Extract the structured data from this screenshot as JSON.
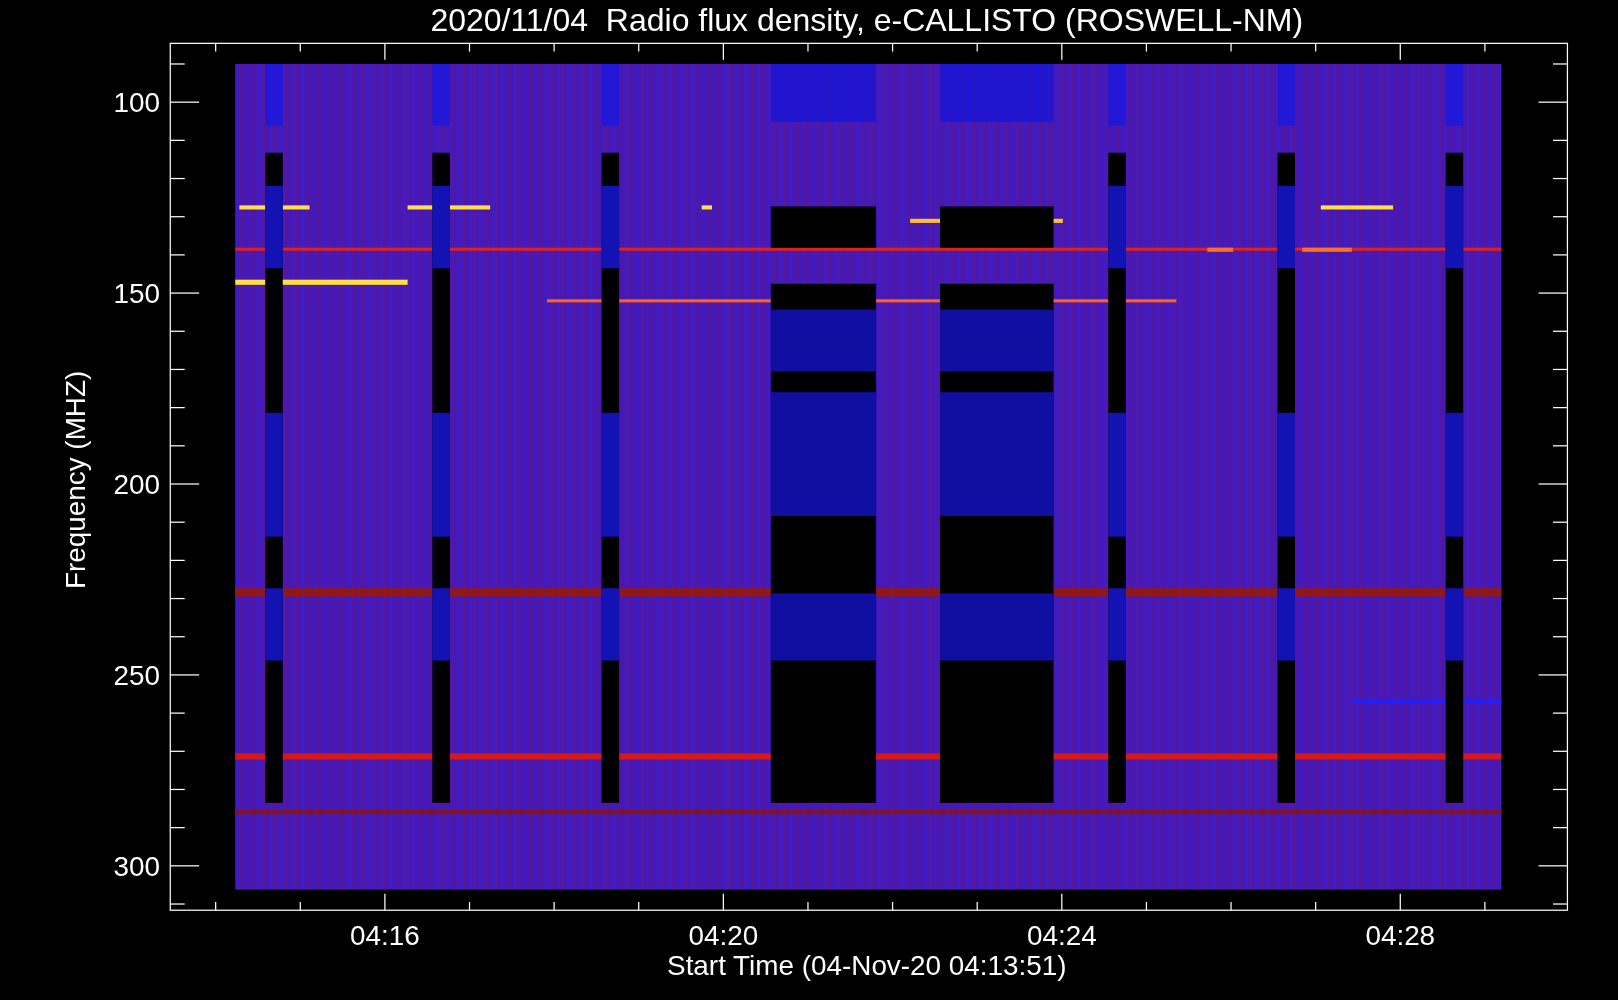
{
  "title": "2020/11/04  Radio flux density, e-CALLISTO (ROSWELL-NM)",
  "chart": {
    "xlabel": "Start Time (04-Nov-20 04:13:51)",
    "ylabel": "Frequency (MHZ)",
    "xtick_labels": [
      "04:16",
      "04:20",
      "04:24",
      "04:28"
    ],
    "ytick_labels": [
      "100",
      "150",
      "200",
      "250",
      "300"
    ]
  }
}
